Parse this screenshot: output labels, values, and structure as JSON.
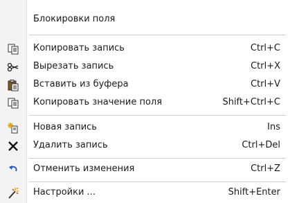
{
  "menu": {
    "items": [
      {
        "label": "Блокировки поля",
        "shortcut": "",
        "icon": ""
      },
      {
        "label": "Копировать запись",
        "shortcut": "Ctrl+C",
        "icon": "copy-icon"
      },
      {
        "label": "Вырезать запись",
        "shortcut": "Ctrl+X",
        "icon": "scissors-icon"
      },
      {
        "label": "Вставить из буфера",
        "shortcut": "Ctrl+V",
        "icon": "paste-icon"
      },
      {
        "label": "Копировать значение поля",
        "shortcut": "Shift+Ctrl+C",
        "icon": "copy-icon"
      },
      {
        "label": "Новая запись",
        "shortcut": "Ins",
        "icon": "new-record-icon"
      },
      {
        "label": "Удалить запись",
        "shortcut": "Ctrl+Del",
        "icon": "delete-x-icon"
      },
      {
        "label": "Отменить изменения",
        "shortcut": "Ctrl+Z",
        "icon": "undo-icon"
      },
      {
        "label": "Настройки ...",
        "shortcut": "Shift+Enter",
        "icon": "settings-wand-icon"
      }
    ]
  },
  "colors": {
    "icon_gutter": "#f3f3f3",
    "separator": "#d0d0d0",
    "delete_x": "#111111",
    "paste_brown": "#7a5a2a",
    "undo_blue": "#1f4fbf"
  }
}
